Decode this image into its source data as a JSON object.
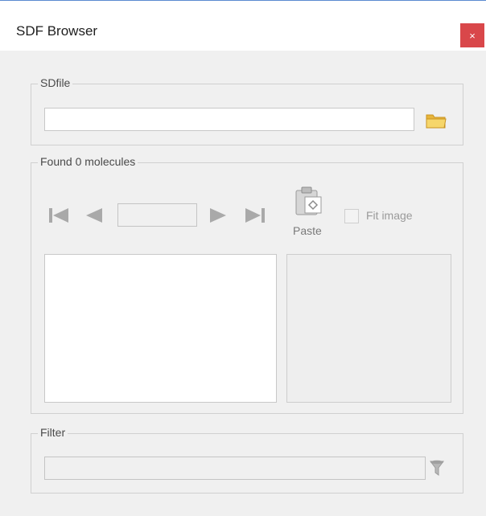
{
  "window": {
    "title": "SDF Browser",
    "close_label": "×"
  },
  "sdfile": {
    "label": "SDfile",
    "path_value": "",
    "browse_icon": "folder-icon"
  },
  "molecules": {
    "label": "Found 0 molecules",
    "nav": {
      "first_icon": "first-record-icon",
      "prev_icon": "previous-record-icon",
      "record_value": "",
      "next_icon": "next-record-icon",
      "last_icon": "last-record-icon"
    },
    "paste_label": "Paste",
    "fit_image_label": "Fit image",
    "fit_image_checked": false
  },
  "filter": {
    "label": "Filter",
    "value": "",
    "filter_icon": "funnel-icon"
  },
  "colors": {
    "accent": "#5b8bd1",
    "close": "#d9474a",
    "folder": "#f2cf5b"
  }
}
